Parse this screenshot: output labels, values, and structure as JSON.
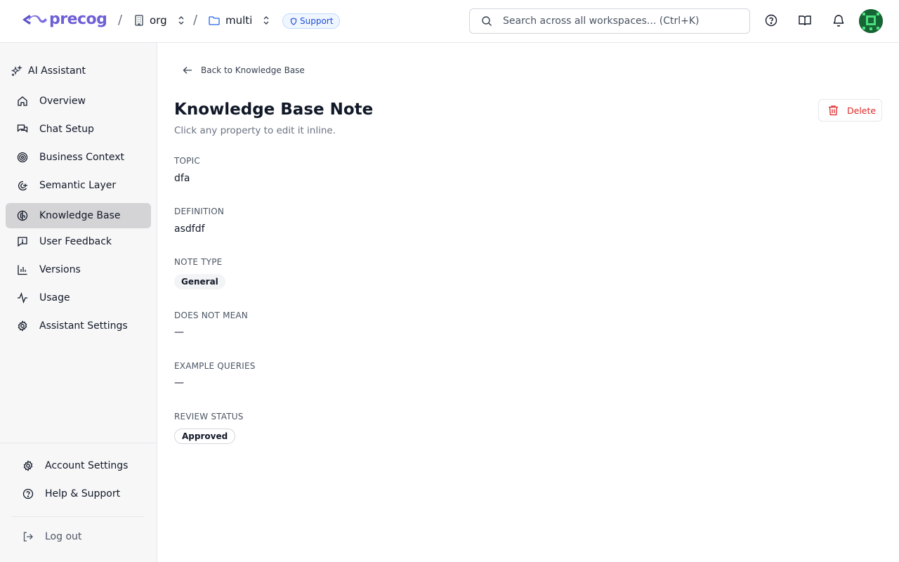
{
  "header": {
    "logo_text": "precog",
    "org_label": "org",
    "workspace_label": "multi",
    "support_badge": "Support",
    "search_placeholder": "Search across all workspaces... (Ctrl+K)"
  },
  "sidebar": {
    "section_title": "AI Assistant",
    "items": [
      {
        "label": "Overview",
        "icon": "home-icon"
      },
      {
        "label": "Chat Setup",
        "icon": "chat-icon"
      },
      {
        "label": "Business Context",
        "icon": "target-icon"
      },
      {
        "label": "Semantic Layer",
        "icon": "semantic-icon"
      },
      {
        "label": "Knowledge Base",
        "icon": "brain-icon",
        "active": true
      },
      {
        "label": "User Feedback",
        "icon": "feedback-icon"
      },
      {
        "label": "Versions",
        "icon": "bar-chart-icon"
      },
      {
        "label": "Usage",
        "icon": "activity-icon"
      },
      {
        "label": "Assistant Settings",
        "icon": "gear-icon"
      }
    ],
    "account_settings": "Account Settings",
    "help_support": "Help & Support",
    "logout": "Log out"
  },
  "main": {
    "back_label": "Back to Knowledge Base",
    "title": "Knowledge Base Note",
    "subtitle": "Click any property to edit it inline.",
    "delete_label": "Delete",
    "properties": {
      "topic_label": "TOPIC",
      "topic_value": "dfa",
      "definition_label": "DEFINITION",
      "definition_value": "asdfdf",
      "note_type_label": "NOTE TYPE",
      "note_type_value": "General",
      "does_not_mean_label": "DOES NOT MEAN",
      "does_not_mean_value": "—",
      "example_queries_label": "EXAMPLE QUERIES",
      "example_queries_value": "—",
      "review_status_label": "REVIEW STATUS",
      "review_status_value": "Approved"
    }
  },
  "colors": {
    "brand": "#6d5fd6",
    "delete": "#dc2626",
    "support_badge": "#1d4ed8",
    "active_nav": "#d4d4d6"
  }
}
